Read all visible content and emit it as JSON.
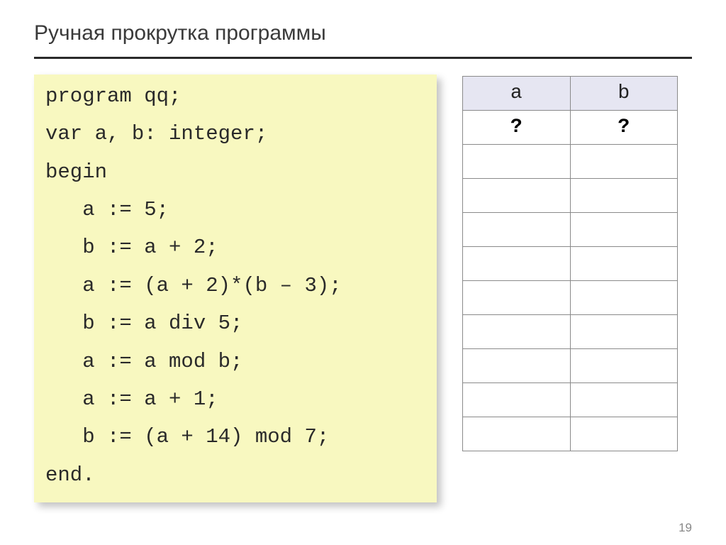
{
  "title": "Ручная прокрутка программы",
  "code": [
    "program qq;",
    "var a, b: integer;",
    "begin",
    "   a := 5;",
    "   b := a + 2;",
    "   a := (a + 2)*(b – 3);",
    "   b := a div 5;",
    "   a := a mod b;",
    "   a := a + 1;",
    "   b := (a + 14) mod 7;",
    "end."
  ],
  "table": {
    "headers": [
      "a",
      "b"
    ],
    "rows": [
      [
        "?",
        "?"
      ],
      [
        "",
        ""
      ],
      [
        "",
        ""
      ],
      [
        "",
        ""
      ],
      [
        "",
        ""
      ],
      [
        "",
        ""
      ],
      [
        "",
        ""
      ],
      [
        "",
        ""
      ],
      [
        "",
        ""
      ],
      [
        "",
        ""
      ]
    ]
  },
  "page_number": "19"
}
